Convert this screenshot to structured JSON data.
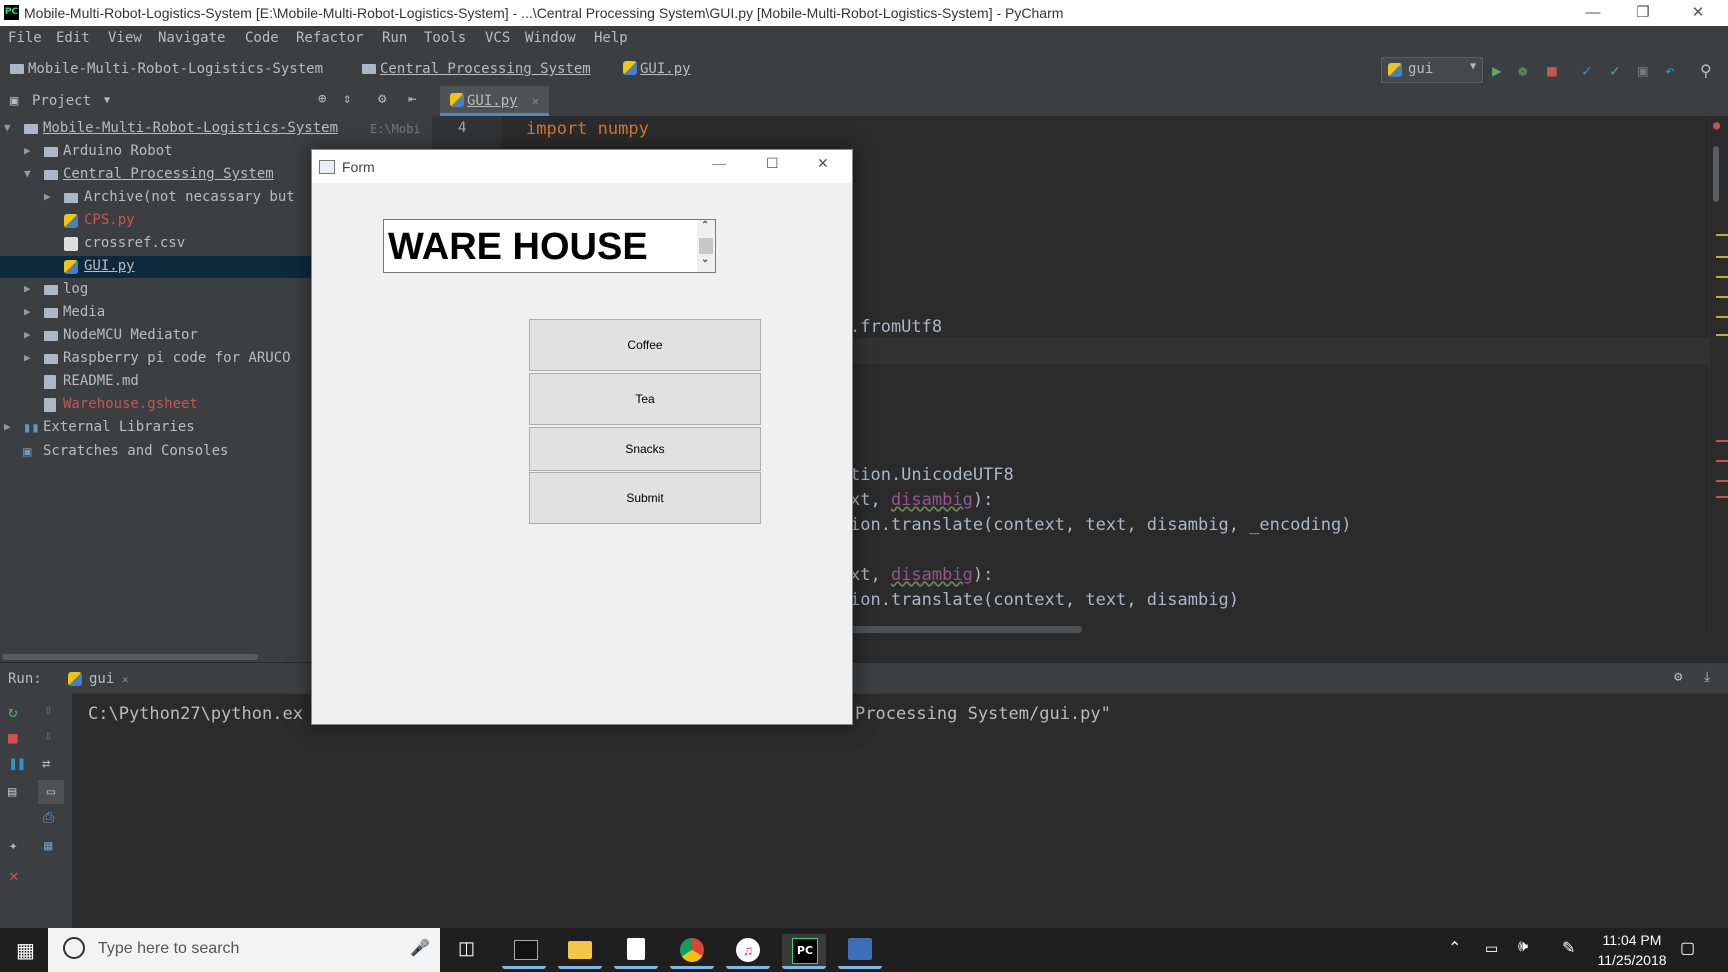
{
  "window": {
    "title": "Mobile-Multi-Robot-Logistics-System [E:\\Mobile-Multi-Robot-Logistics-System] - ...\\Central Processing System\\GUI.py [Mobile-Multi-Robot-Logistics-System] - PyCharm",
    "app_icon": "PC"
  },
  "menu": [
    "File",
    "Edit",
    "View",
    "Navigate",
    "Code",
    "Refactor",
    "Run",
    "Tools",
    "VCS",
    "Window",
    "Help"
  ],
  "breadcrumbs": [
    "Mobile-Multi-Robot-Logistics-System",
    "Central Processing System",
    "GUI.py"
  ],
  "run_config": "gui",
  "project": {
    "header": "Project",
    "tree": [
      {
        "label": "Mobile-Multi-Robot-Logistics-System",
        "hint": "E:\\Mobi",
        "depth": 0,
        "expanded": true,
        "kind": "folder",
        "color": "#bbbbbb"
      },
      {
        "label": "Arduino Robot",
        "depth": 1,
        "expanded": false,
        "kind": "folder",
        "color": "#bbbbbb"
      },
      {
        "label": "Central Processing System",
        "depth": 1,
        "expanded": true,
        "kind": "folder",
        "color": "#bbbbbb"
      },
      {
        "label": "Archive(not necassary but",
        "depth": 2,
        "expanded": false,
        "kind": "folder",
        "color": "#bbbbbb"
      },
      {
        "label": "CPS.py",
        "depth": 2,
        "kind": "python",
        "color": "#c75450"
      },
      {
        "label": "crossref.csv",
        "depth": 2,
        "kind": "csv",
        "color": "#bbbbbb"
      },
      {
        "label": "GUI.py",
        "depth": 2,
        "kind": "python",
        "color": "#bbbbbb",
        "selected": true
      },
      {
        "label": "log",
        "depth": 1,
        "expanded": false,
        "kind": "folder",
        "color": "#bbbbbb"
      },
      {
        "label": "Media",
        "depth": 1,
        "expanded": false,
        "kind": "folder",
        "color": "#bbbbbb"
      },
      {
        "label": "NodeMCU Mediator",
        "depth": 1,
        "expanded": false,
        "kind": "folder",
        "color": "#bbbbbb"
      },
      {
        "label": "Raspberry pi code for ARUCO",
        "depth": 1,
        "expanded": false,
        "kind": "folder",
        "color": "#bbbbbb"
      },
      {
        "label": "README.md",
        "depth": 1,
        "kind": "file",
        "color": "#bbbbbb"
      },
      {
        "label": "Warehouse.gsheet",
        "depth": 1,
        "kind": "file",
        "color": "#c75450"
      },
      {
        "label": "External Libraries",
        "depth": 0,
        "expanded": false,
        "kind": "lib",
        "color": "#bbbbbb"
      },
      {
        "label": "Scratches and Consoles",
        "depth": 0,
        "kind": "scratch",
        "color": "#bbbbbb"
      }
    ]
  },
  "editor": {
    "tab": "GUI.py",
    "line_number": "4",
    "lines": {
      "l1": "import numpy",
      "l2": ".fromUtf8",
      "l3": "tion.UnicodeUTF8",
      "l4a": "xt, ",
      "l4b": "disambig",
      "l4c": "):",
      "l5": "ion.translate(context, text, disambig, _encoding)",
      "l6a": "xt, ",
      "l6b": "disambig",
      "l6c": "):",
      "l7": "ion.translate(context, text, disambig)"
    }
  },
  "run": {
    "label": "Run:",
    "tab": "gui",
    "console_left": "C:\\Python27\\python.ex",
    "console_right": "Processing System/gui.py\""
  },
  "form": {
    "title": "Form",
    "header_text": "WARE HOUSE",
    "buttons": [
      "Coffee",
      "Tea",
      "Snacks",
      "Submit"
    ]
  },
  "taskbar": {
    "search_placeholder": "Type here to search",
    "time": "11:04 PM",
    "date": "11/25/2018"
  }
}
